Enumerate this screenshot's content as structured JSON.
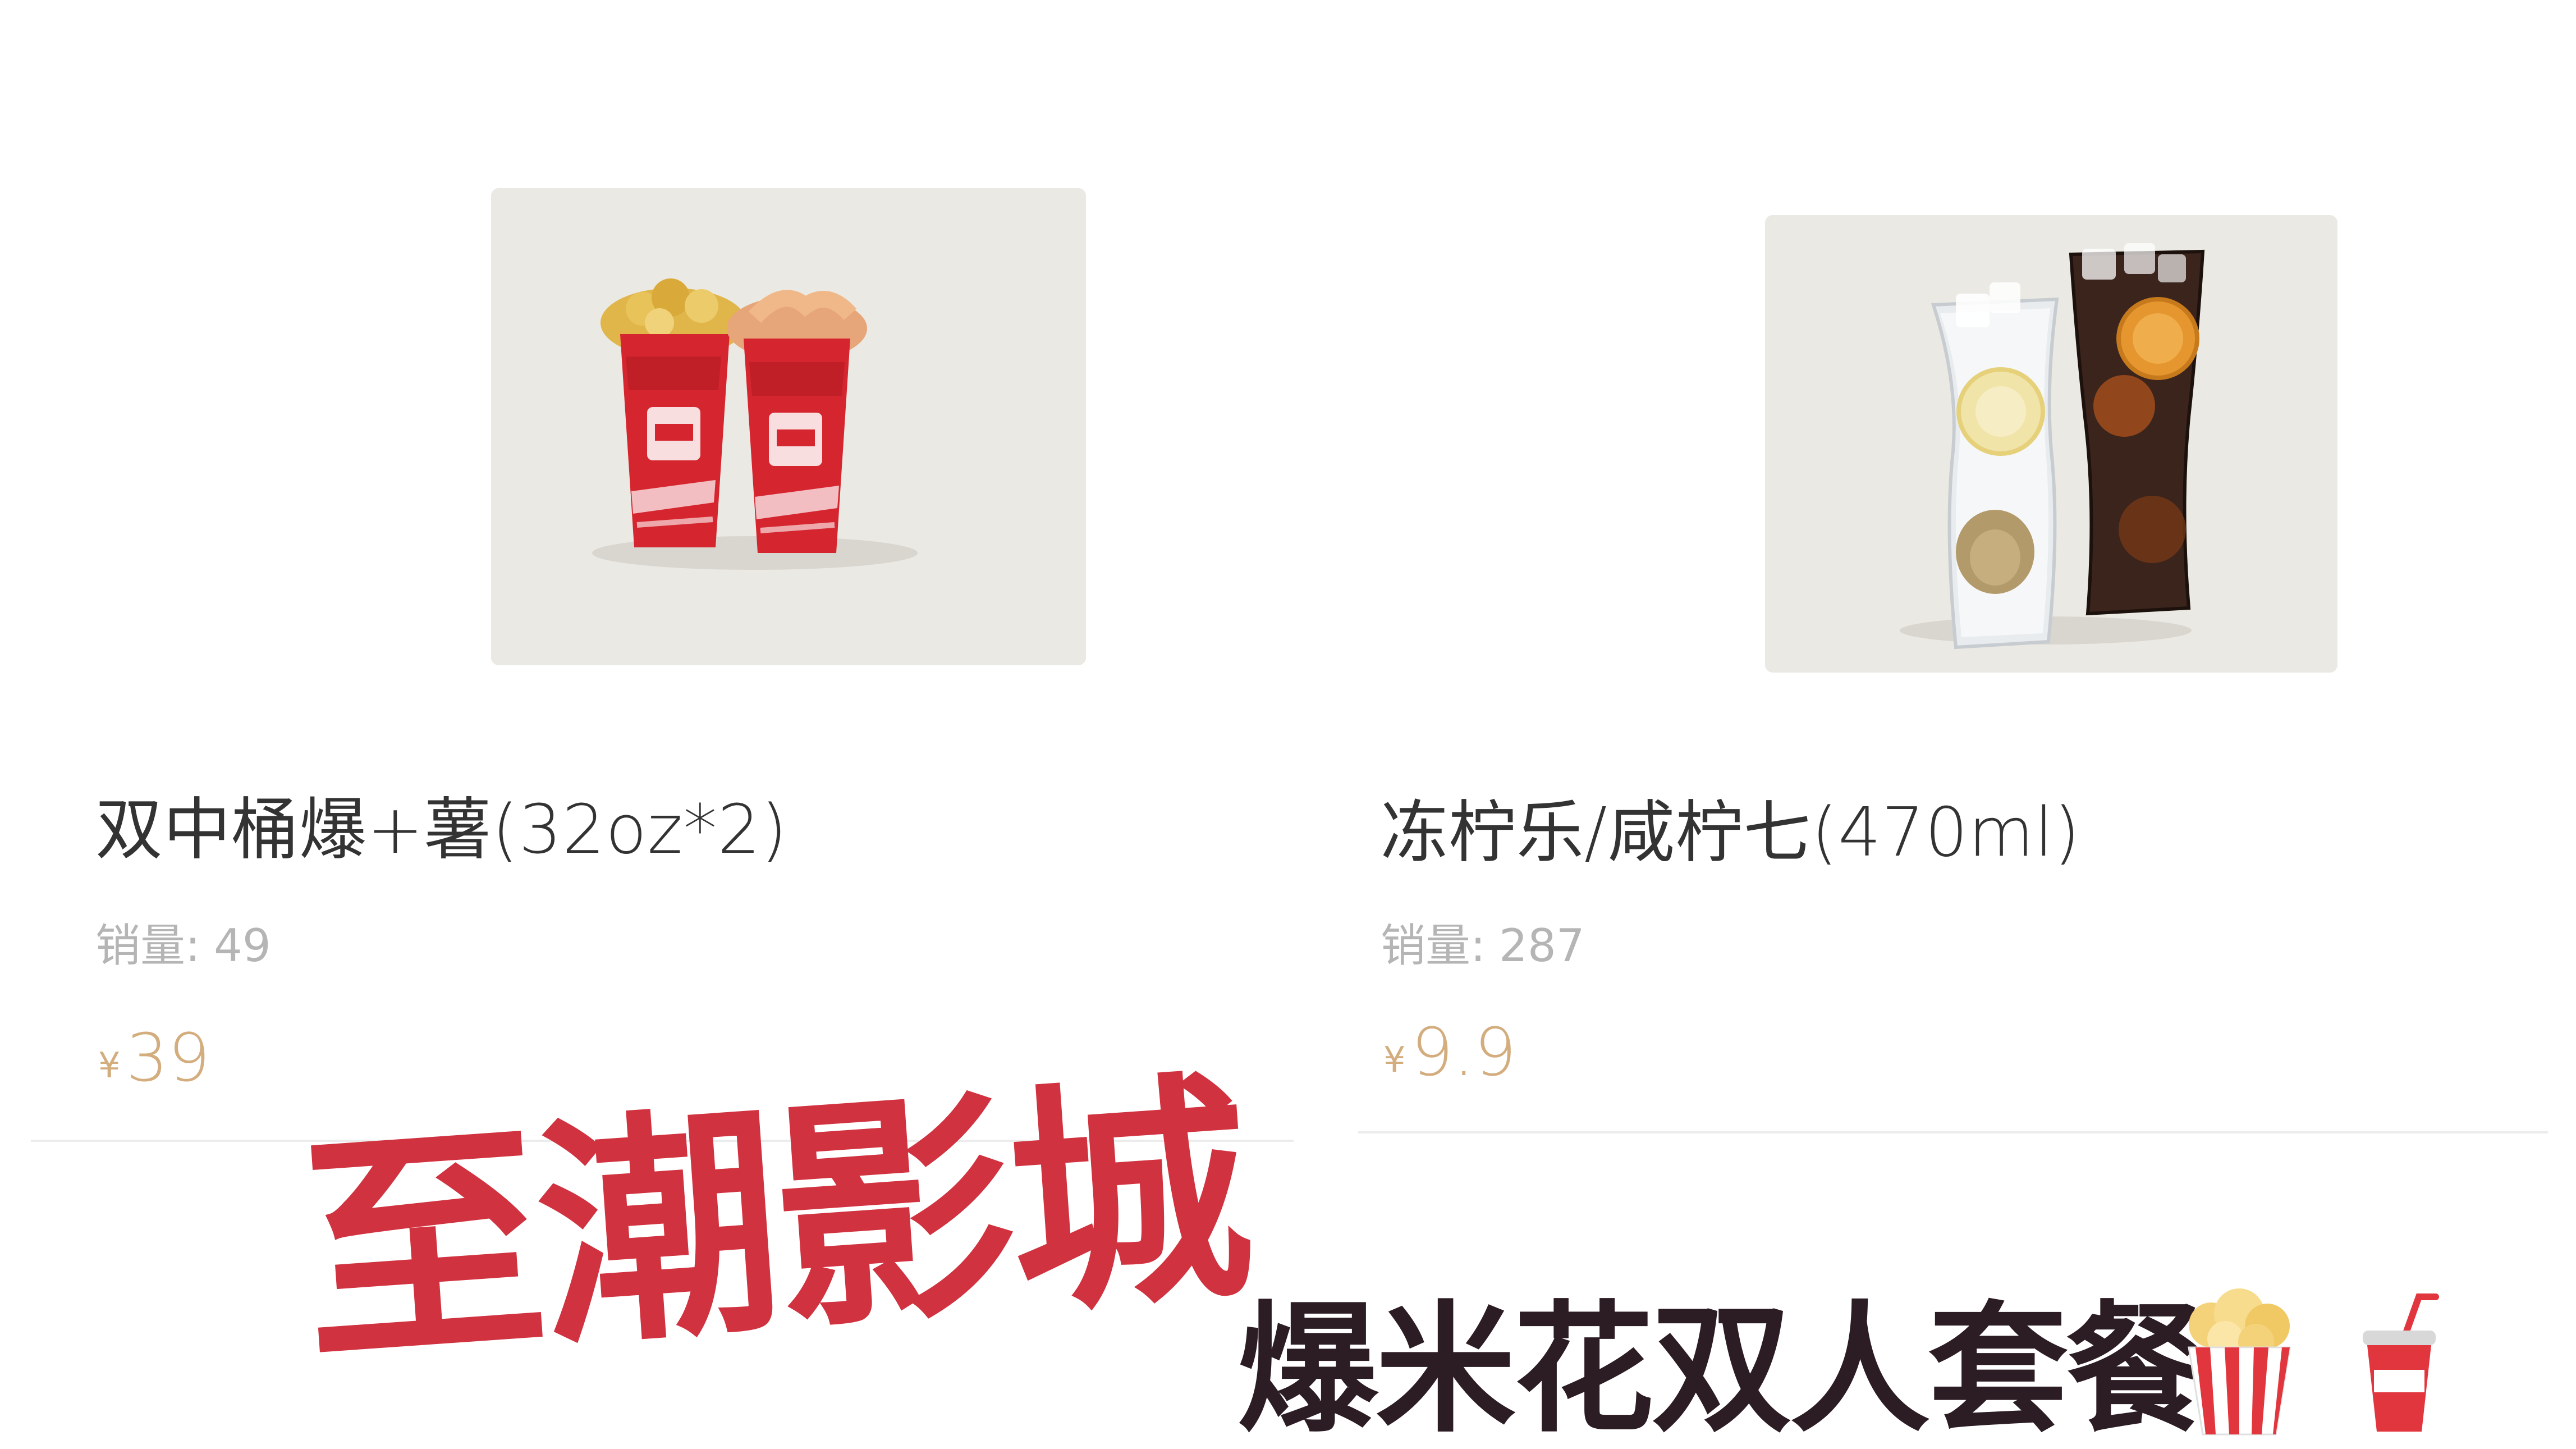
{
  "products": [
    {
      "name": "双中桶爆+薯(32oz*2)",
      "sales_label": "销量:",
      "sales_value": "49",
      "currency": "¥",
      "price": "39",
      "image_icon": "popcorn-buckets-image"
    },
    {
      "name": "冻柠乐/咸柠七(470ml)",
      "sales_label": "销量:",
      "sales_value": "287",
      "currency": "¥",
      "price": "9.9",
      "image_icon": "iced-drinks-image"
    }
  ],
  "overlay": {
    "title": "至潮影城",
    "subtitle": "爆米花双人套餐"
  },
  "colors": {
    "price": "#d3ad7e",
    "title_red": "#d1323f",
    "subtitle_dark": "#2c1c24",
    "muted_text": "#b5b5b5",
    "name_text": "#333333",
    "divider": "#ececec",
    "image_bg": "#ebe9e3"
  },
  "icons": [
    "popcorn-icon",
    "drink-cup-icon"
  ]
}
